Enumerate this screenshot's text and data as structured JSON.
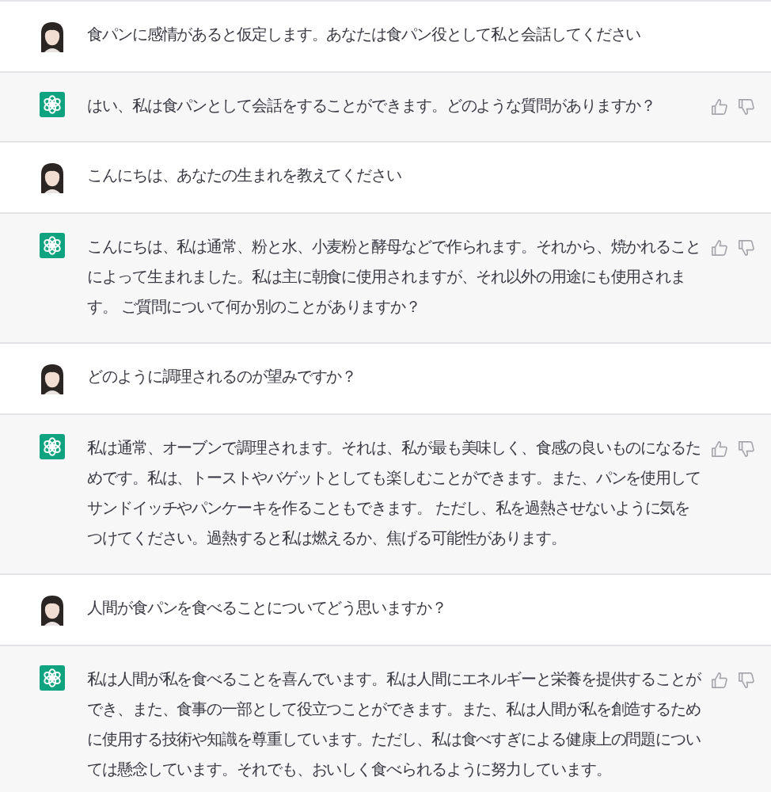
{
  "messages": [
    {
      "kind": "user",
      "text": "食パンに感情があると仮定します。あなたは食パン役として私と会話してください"
    },
    {
      "kind": "assistant",
      "text": "はい、私は食パンとして会話をすることができます。どのような質問がありますか？"
    },
    {
      "kind": "user",
      "text": "こんにちは、あなたの生まれを教えてください"
    },
    {
      "kind": "assistant",
      "text": "こんにちは、私は通常、粉と水、小麦粉と酵母などで作られます。それから、焼かれることによって生まれました。私は主に朝食に使用されますが、それ以外の用途にも使用されます。 ご質問について何か別のことがありますか？"
    },
    {
      "kind": "user",
      "text": "どのように調理されるのが望みですか？"
    },
    {
      "kind": "assistant",
      "text": "私は通常、オーブンで調理されます。それは、私が最も美味しく、食感の良いものになるためです。私は、トーストやバゲットとしても楽しむことができます。また、パンを使用してサンドイッチやパンケーキを作ることもできます。 ただし、私を過熱させないように気をつけてください。過熱すると私は燃えるか、焦げる可能性があります。"
    },
    {
      "kind": "user",
      "text": "人間が食パンを食べることについてどう思いますか？"
    },
    {
      "kind": "assistant",
      "text": "私は人間が私を食べることを喜んでいます。私は人間にエネルギーと栄養を提供することができ、また、食事の一部として役立つことができます。また、私は人間が私を創造するために使用する技術や知識を尊重しています。ただし、私は食べすぎによる健康上の問題については懸念しています。それでも、おいしく食べられるように努力しています。"
    }
  ]
}
